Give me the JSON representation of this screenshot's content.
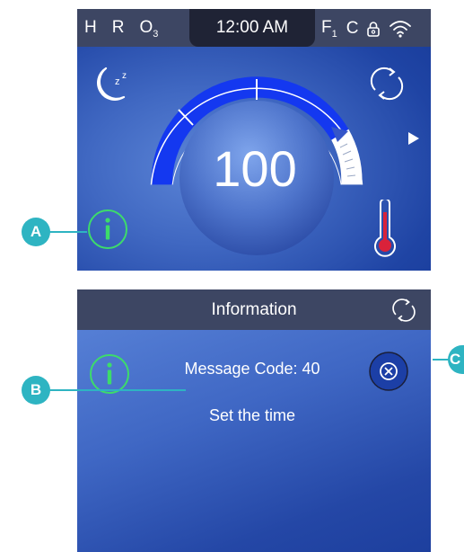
{
  "top_panel": {
    "status_bar": {
      "indicators_left": [
        {
          "main": "H",
          "sub": ""
        },
        {
          "main": "R",
          "sub": ""
        },
        {
          "main": "O",
          "sub": "3"
        }
      ],
      "time": "12:00 AM",
      "indicators_right": [
        {
          "main": "F",
          "sub": "1"
        },
        {
          "main": "C",
          "sub": ""
        }
      ],
      "icons": [
        "lock-icon",
        "wifi-icon"
      ]
    },
    "dial": {
      "value": "100",
      "level_fraction": 0.72
    },
    "icons": [
      "sleep-icon",
      "refresh-icon",
      "next-arrow-icon",
      "info-icon",
      "thermometer-icon"
    ]
  },
  "bottom_panel": {
    "title": "Information",
    "message_code": "Message Code: 40",
    "message": "Set the time",
    "icons": [
      "info-icon",
      "close-icon",
      "refresh-icon"
    ]
  },
  "callouts": [
    {
      "letter": "A"
    },
    {
      "letter": "B"
    },
    {
      "letter": "C"
    }
  ],
  "colors": {
    "panel_blue": "#3f67c4",
    "header": "#3d4663",
    "dial_fill": "#1438f0",
    "info_green": "#3ddc6a",
    "thermo_red": "#d9223a",
    "callout": "#2eb4c2"
  }
}
